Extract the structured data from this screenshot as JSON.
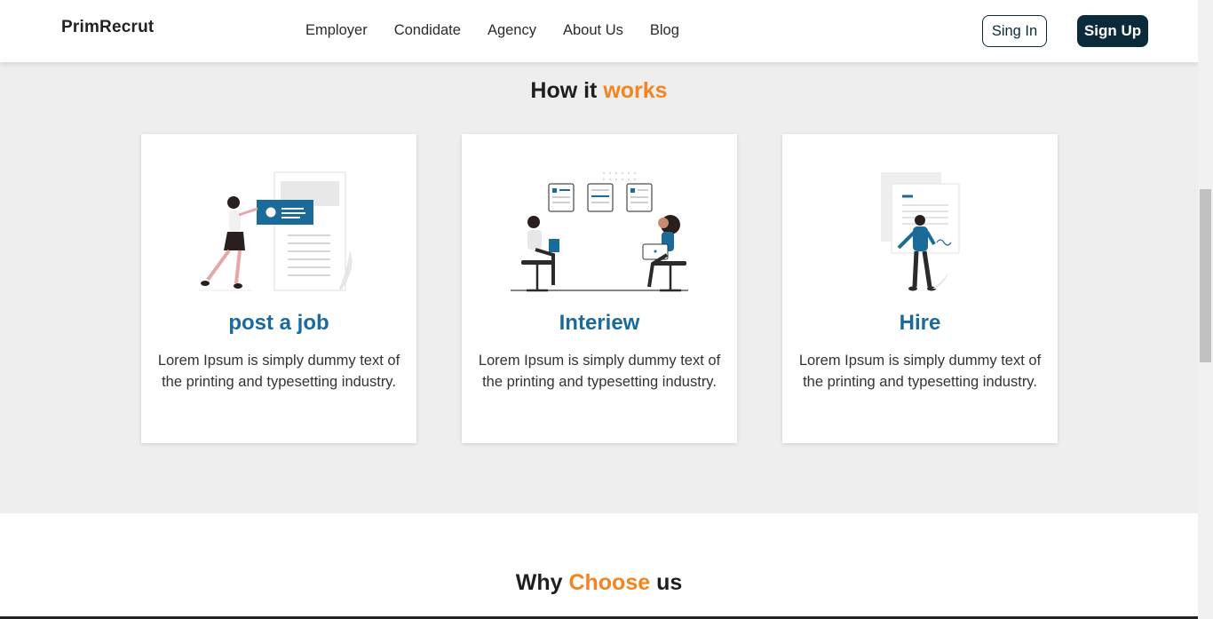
{
  "brand": {
    "name": "PrimRecrut"
  },
  "nav": {
    "links": [
      "Employer",
      "Condidate",
      "Agency",
      "About Us",
      "Blog"
    ],
    "signin_label": "Sing In",
    "signup_label": "Sign Up"
  },
  "how": {
    "title_prefix": "How it ",
    "title_accent": "works",
    "cards": [
      {
        "title": "post a job",
        "text": "Lorem Ipsum is simply dummy text of the printing and typesetting industry.",
        "icon": "post-job-illustration"
      },
      {
        "title": "Interiew",
        "text": "Lorem Ipsum is simply dummy text of the printing and typesetting industry.",
        "icon": "interview-illustration"
      },
      {
        "title": "Hire",
        "text": "Lorem Ipsum is simply dummy text of the printing and typesetting industry.",
        "icon": "hire-illustration"
      }
    ]
  },
  "why": {
    "title_prefix": "Why ",
    "title_accent": "Choose",
    "title_suffix": " us"
  },
  "colors": {
    "accent": "#f5841f",
    "navy": "#0b2a3c",
    "card_title": "#1a6b9a",
    "section_bg": "#eeeeee"
  }
}
